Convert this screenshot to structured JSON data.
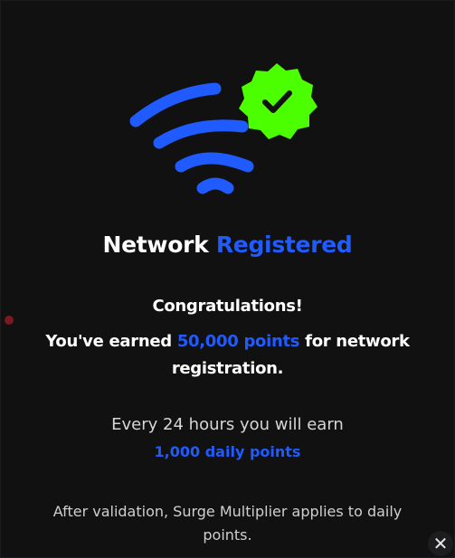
{
  "hero": {
    "wifi_icon": "wifi-icon",
    "badge_icon": "verified-badge-check-icon",
    "wifi_color": "#1f5bff",
    "badge_color": "#4cff00"
  },
  "title": {
    "prefix": "Network ",
    "accent": "Registered"
  },
  "message": {
    "congrats": "Congratulations!",
    "earned_prefix": "You've earned ",
    "earned_points": "50,000 points",
    "earned_suffix": " for network registration."
  },
  "daily": {
    "every": "Every 24 hours you will earn",
    "points": "1,000 daily points"
  },
  "note": "After validation, Surge Multiplier applies to daily points.",
  "close": {
    "icon": "close-icon",
    "glyph": "✕"
  },
  "colors": {
    "accent": "#1f5bff",
    "success": "#4cff00",
    "background": "#111112"
  }
}
